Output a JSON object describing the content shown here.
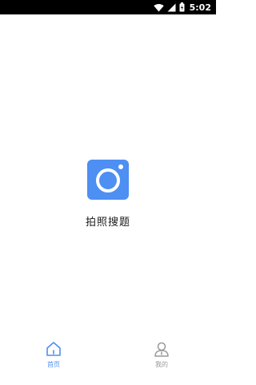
{
  "status_bar": {
    "time": "5:02",
    "icons": [
      "wifi-icon",
      "cell-signal-icon",
      "battery-charging-icon"
    ]
  },
  "main": {
    "camera_icon": "camera-icon",
    "camera_label": "拍照搜题"
  },
  "bottom_nav": {
    "items": [
      {
        "label": "首页",
        "icon": "home-icon",
        "active": true
      },
      {
        "label": "我的",
        "icon": "user-icon",
        "active": false
      }
    ]
  },
  "colors": {
    "accent": "#4d8ff2",
    "inactive": "#999999",
    "status_bar_bg": "#000000",
    "background": "#ffffff"
  }
}
